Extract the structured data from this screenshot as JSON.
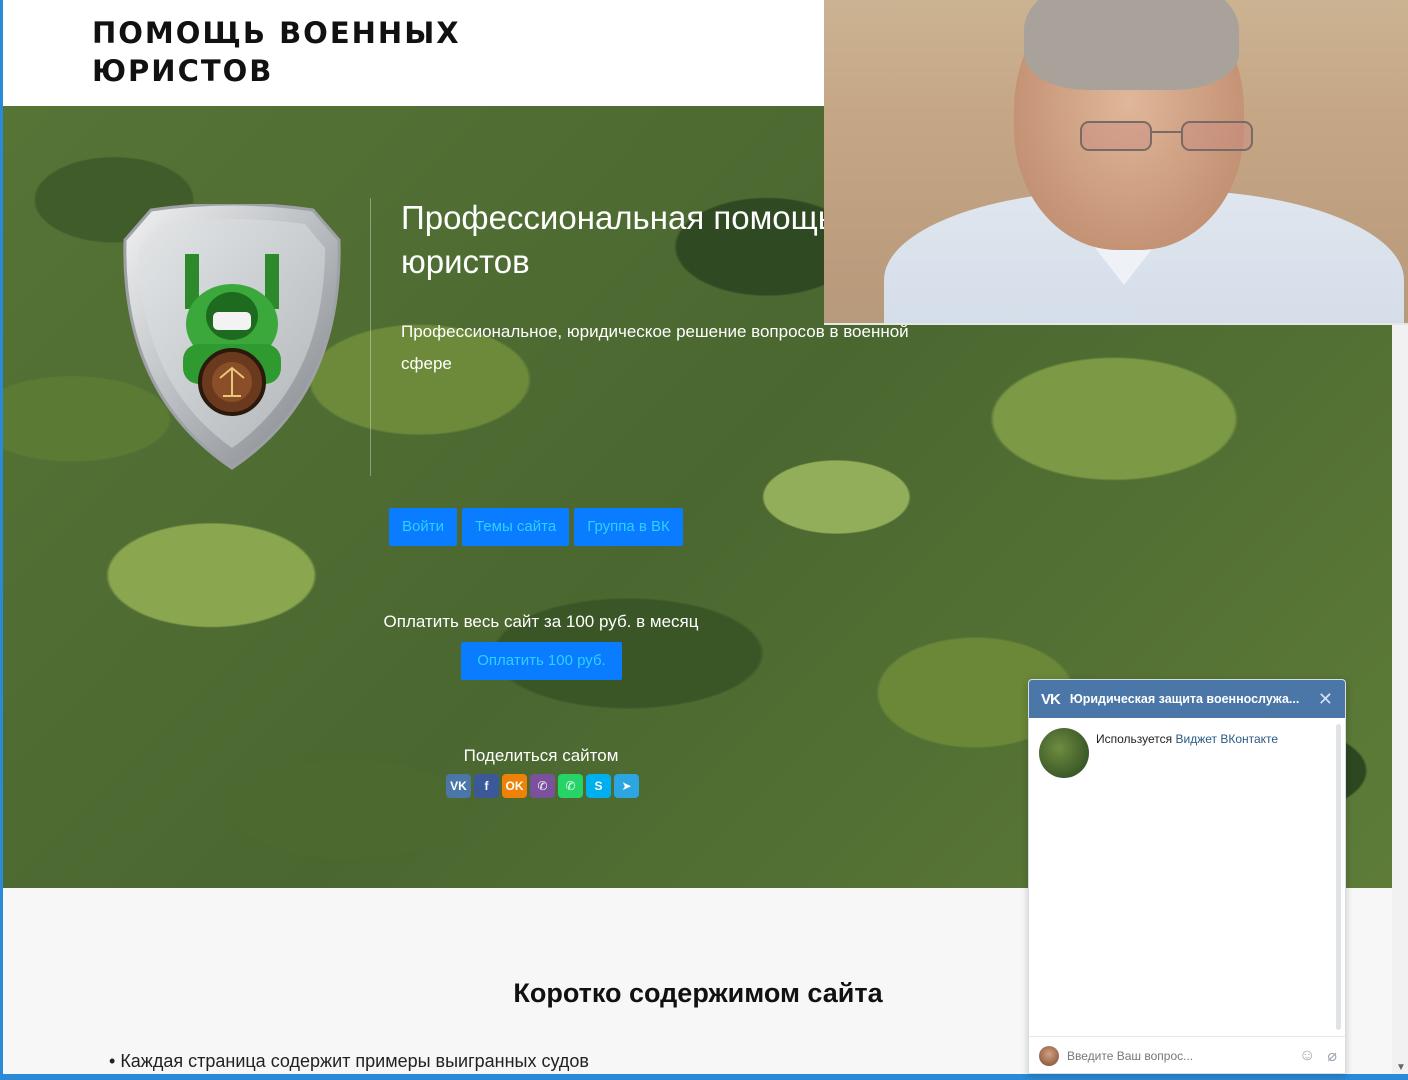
{
  "site": {
    "title": "ПОМОЩЬ ВОЕННЫХ ЮРИСТОВ"
  },
  "hero": {
    "heading": "Профессиональная помощь военных юристов",
    "subheading": "Профессиональное, юридическое решение вопросов в военной сфере",
    "buttons": [
      "Войти",
      "Темы сайта",
      "Группа в ВК"
    ],
    "pay_text": "Оплатить весь сайт за 100 руб. в месяц",
    "pay_button": "Оплатить 100 руб.",
    "share_title": "Поделиться сайтом",
    "share_icons": [
      {
        "name": "vk-icon",
        "glyph": "VK",
        "color": "#4a76a8"
      },
      {
        "name": "facebook-icon",
        "glyph": "f",
        "color": "#3b5998"
      },
      {
        "name": "odnoklassniki-icon",
        "glyph": "OK",
        "color": "#ee8208"
      },
      {
        "name": "viber-icon",
        "glyph": "✆",
        "color": "#7b519d"
      },
      {
        "name": "whatsapp-icon",
        "glyph": "✆",
        "color": "#25d366"
      },
      {
        "name": "skype-icon",
        "glyph": "S",
        "color": "#00aff0"
      },
      {
        "name": "telegram-icon",
        "glyph": "➤",
        "color": "#2ca5e0"
      }
    ]
  },
  "content": {
    "section_title": "Коротко содержимом сайта",
    "items": [
      "Каждая страница содержит примеры выигранных судов"
    ]
  },
  "vk_widget": {
    "title": "Юридическая защита военнослужа...",
    "info_prefix": "Используется ",
    "info_link": "Виджет ВКонтакте",
    "input_placeholder": "Введите Ваш вопрос..."
  },
  "colors": {
    "accent_blue": "#0a7cff",
    "button_text": "#2fd0ff",
    "vk_header": "#4a76a8",
    "edge_blue": "#2a8ad8"
  }
}
